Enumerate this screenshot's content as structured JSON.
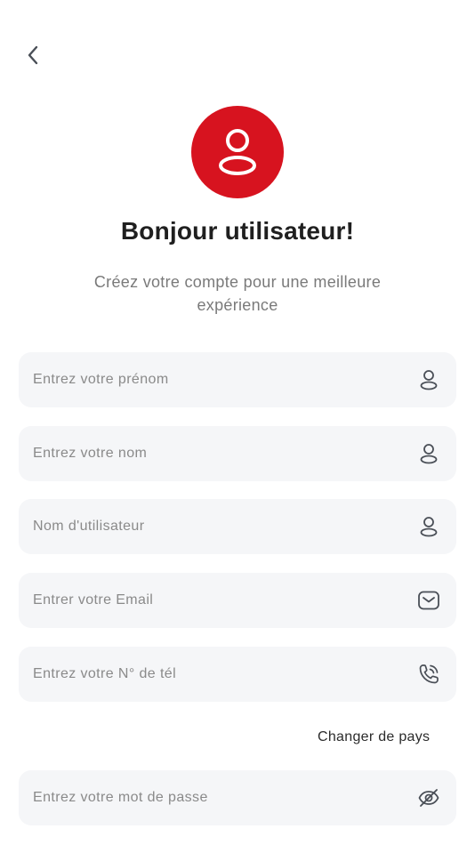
{
  "colors": {
    "accent": "#d7131f",
    "field_bg": "#f5f6f8",
    "icon": "#4a4f57"
  },
  "header": {
    "back_icon": "chevron-left-icon",
    "avatar_icon": "user-icon",
    "title": "Bonjour utilisateur!",
    "subtitle": "Créez votre compte pour une meilleure expérience"
  },
  "form": {
    "first_name": {
      "placeholder": "Entrez votre prénom",
      "value": "",
      "icon": "user-icon"
    },
    "last_name": {
      "placeholder": "Entrez votre nom",
      "value": "",
      "icon": "user-icon"
    },
    "username": {
      "placeholder": "Nom d'utilisateur",
      "value": "",
      "icon": "user-icon"
    },
    "email": {
      "placeholder": "Entrer votre Email",
      "value": "",
      "icon": "mail-icon"
    },
    "phone": {
      "placeholder": "Entrez votre N° de tél",
      "value": "",
      "icon": "phone-icon"
    },
    "change_country_label": "Changer de pays",
    "password": {
      "placeholder": "Entrez votre mot de passe",
      "value": "",
      "icon": "eye-off-icon"
    }
  }
}
